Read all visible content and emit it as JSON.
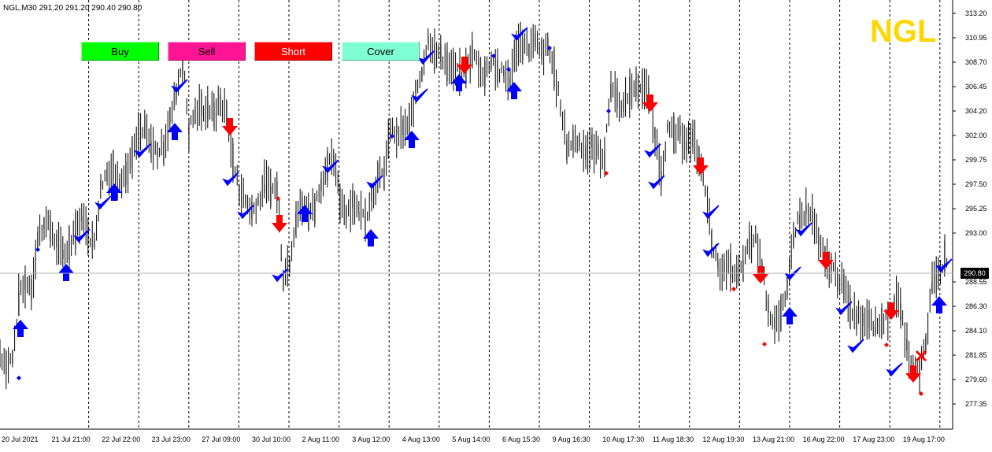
{
  "window": {
    "symbol_info": "NGL,M30  291.20 291.20 290.40 290.80",
    "watermark": "NGL"
  },
  "toolbar": {
    "buy_label": "Buy",
    "sell_label": "Sell",
    "short_label": "Short",
    "cover_label": "Cover"
  },
  "colors": {
    "buy": "#00FF00",
    "sell": "#FF1493",
    "short": "#FF0000",
    "cover": "#7FFFD4",
    "up_arrow": "#0000FF",
    "down_arrow": "#FF0000",
    "watermark": "#FFD700"
  },
  "icons": [
    "check-icon",
    "up-arrow-icon",
    "down-arrow-icon",
    "cross-icon",
    "diamond-marker-icon"
  ],
  "price_axis": {
    "labels": [
      "313.20",
      "310.95",
      "308.70",
      "306.45",
      "304.20",
      "302.00",
      "299.75",
      "297.50",
      "295.25",
      "293.00",
      "290.80",
      "288.55",
      "286.30",
      "284.10",
      "281.85",
      "279.60",
      "277.35"
    ],
    "current_price": "290.80"
  },
  "time_axis": {
    "labels": [
      "20 Jul 2021",
      "21 Jul 21:00",
      "22 Jul 22:00",
      "23 Jul 23:00",
      "27 Jul 09:00",
      "30 Jul 10:00",
      "2 Aug 11:00",
      "3 Aug 12:00",
      "4 Aug 13:00",
      "5 Aug 14:00",
      "6 Aug 15:30",
      "9 Aug 16:30",
      "10 Aug 17:30",
      "11 Aug 18:30",
      "12 Aug 19:30",
      "13 Aug 21:00",
      "16 Aug 22:00",
      "17 Aug 23:00",
      "19 Aug 17:00"
    ]
  },
  "chart_data": {
    "type": "line",
    "ylim": [
      277.35,
      313.2
    ],
    "close_path": [
      [
        0,
        282.0
      ],
      [
        8,
        281.0
      ],
      [
        16,
        281.5
      ],
      [
        24,
        287.0
      ],
      [
        32,
        288.5
      ],
      [
        40,
        288.0
      ],
      [
        48,
        292.5
      ],
      [
        56,
        294.0
      ],
      [
        64,
        293.5
      ],
      [
        72,
        292.0
      ],
      [
        80,
        291.0
      ],
      [
        88,
        292.0
      ],
      [
        96,
        293.5
      ],
      [
        104,
        294.5
      ],
      [
        112,
        293.0
      ],
      [
        120,
        292.0
      ],
      [
        128,
        297.5
      ],
      [
        136,
        298.5
      ],
      [
        144,
        299.0
      ],
      [
        152,
        298.0
      ],
      [
        160,
        298.5
      ],
      [
        168,
        300.0
      ],
      [
        176,
        302.0
      ],
      [
        184,
        302.5
      ],
      [
        192,
        301.0
      ],
      [
        200,
        300.5
      ],
      [
        208,
        301.0
      ],
      [
        216,
        303.5
      ],
      [
        224,
        306.0
      ],
      [
        232,
        309.0
      ],
      [
        240,
        302.5
      ],
      [
        248,
        304.0
      ],
      [
        256,
        304.5
      ],
      [
        264,
        304.5
      ],
      [
        272,
        304.0
      ],
      [
        280,
        305.0
      ],
      [
        288,
        304.0
      ],
      [
        296,
        299.5
      ],
      [
        304,
        297.0
      ],
      [
        312,
        296.0
      ],
      [
        320,
        295.0
      ],
      [
        328,
        296.0
      ],
      [
        336,
        297.5
      ],
      [
        344,
        297.0
      ],
      [
        352,
        297.0
      ],
      [
        360,
        289.0
      ],
      [
        368,
        290.5
      ],
      [
        376,
        294.5
      ],
      [
        384,
        295.5
      ],
      [
        392,
        295.0
      ],
      [
        400,
        295.5
      ],
      [
        408,
        297.5
      ],
      [
        416,
        299.5
      ],
      [
        424,
        299.5
      ],
      [
        432,
        296.0
      ],
      [
        440,
        295.0
      ],
      [
        448,
        296.0
      ],
      [
        456,
        295.0
      ],
      [
        464,
        294.5
      ],
      [
        472,
        296.5
      ],
      [
        480,
        298.0
      ],
      [
        488,
        298.5
      ],
      [
        496,
        302.5
      ],
      [
        504,
        302.0
      ],
      [
        512,
        302.5
      ],
      [
        520,
        303.0
      ],
      [
        528,
        306.0
      ],
      [
        536,
        308.0
      ],
      [
        544,
        311.0
      ],
      [
        552,
        309.5
      ],
      [
        560,
        309.5
      ],
      [
        568,
        308.5
      ],
      [
        576,
        308.0
      ],
      [
        584,
        307.5
      ],
      [
        592,
        308.0
      ],
      [
        600,
        309.5
      ],
      [
        608,
        308.5
      ],
      [
        616,
        307.5
      ],
      [
        624,
        309.0
      ],
      [
        632,
        308.0
      ],
      [
        640,
        307.5
      ],
      [
        648,
        307.0
      ],
      [
        656,
        310.0
      ],
      [
        664,
        310.5
      ],
      [
        672,
        310.0
      ],
      [
        680,
        310.5
      ],
      [
        688,
        309.5
      ],
      [
        696,
        310.0
      ],
      [
        704,
        308.0
      ],
      [
        712,
        304.5
      ],
      [
        720,
        301.0
      ],
      [
        728,
        301.5
      ],
      [
        736,
        301.5
      ],
      [
        744,
        300.5
      ],
      [
        752,
        301.0
      ],
      [
        760,
        300.5
      ],
      [
        768,
        300.0
      ],
      [
        776,
        306.5
      ],
      [
        784,
        305.5
      ],
      [
        792,
        304.5
      ],
      [
        800,
        306.0
      ],
      [
        808,
        306.5
      ],
      [
        816,
        306.5
      ],
      [
        824,
        305.5
      ],
      [
        832,
        302.0
      ],
      [
        840,
        298.5
      ],
      [
        848,
        302.5
      ],
      [
        856,
        302.0
      ],
      [
        864,
        302.0
      ],
      [
        872,
        301.5
      ],
      [
        880,
        301.5
      ],
      [
        888,
        300.0
      ],
      [
        896,
        297.0
      ],
      [
        904,
        292.5
      ],
      [
        912,
        290.0
      ],
      [
        920,
        289.5
      ],
      [
        928,
        290.0
      ],
      [
        936,
        289.0
      ],
      [
        944,
        290.0
      ],
      [
        952,
        292.0
      ],
      [
        960,
        292.5
      ],
      [
        968,
        290.0
      ],
      [
        976,
        286.0
      ],
      [
        984,
        285.0
      ],
      [
        992,
        285.5
      ],
      [
        1000,
        287.5
      ],
      [
        1008,
        293.0
      ],
      [
        1016,
        294.5
      ],
      [
        1024,
        295.0
      ],
      [
        1032,
        294.5
      ],
      [
        1040,
        292.0
      ],
      [
        1048,
        290.5
      ],
      [
        1056,
        290.0
      ],
      [
        1064,
        289.0
      ],
      [
        1072,
        288.0
      ],
      [
        1080,
        286.0
      ],
      [
        1088,
        285.5
      ],
      [
        1096,
        285.0
      ],
      [
        1104,
        285.5
      ],
      [
        1112,
        284.5
      ],
      [
        1120,
        285.0
      ],
      [
        1128,
        285.5
      ],
      [
        1136,
        287.0
      ],
      [
        1144,
        286.0
      ],
      [
        1152,
        282.5
      ],
      [
        1160,
        281.0
      ],
      [
        1168,
        280.5
      ],
      [
        1176,
        283.0
      ],
      [
        1184,
        288.5
      ],
      [
        1192,
        289.5
      ],
      [
        1200,
        290.8
      ],
      [
        1205,
        290.8
      ]
    ]
  }
}
